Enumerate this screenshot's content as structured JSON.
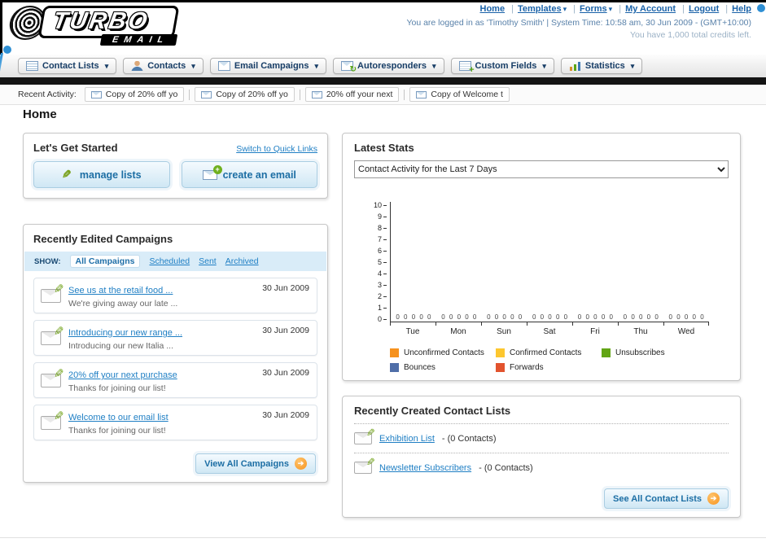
{
  "header": {
    "logo_title": "TURBO",
    "logo_subtitle": "EMAIL",
    "links": [
      {
        "label": "Home"
      },
      {
        "label": "Templates"
      },
      {
        "label": "Forms"
      },
      {
        "label": "My Account"
      },
      {
        "label": "Logout"
      },
      {
        "label": "Help"
      }
    ],
    "session_info": "You are logged in as 'Timothy Smith' | System Time: 10:58 am, 30 Jun 2009 - (GMT+10:00)",
    "credits_info": "You have 1,000 total credits left."
  },
  "nav": {
    "tabs": [
      {
        "label": "Contact Lists"
      },
      {
        "label": "Contacts"
      },
      {
        "label": "Email Campaigns"
      },
      {
        "label": "Autoresponders"
      },
      {
        "label": "Custom Fields"
      },
      {
        "label": "Statistics"
      }
    ]
  },
  "activity_bar": {
    "label": "Recent Activity:",
    "items": [
      "Copy of 20% off yo",
      "Copy of 20% off yo",
      "20% off your next",
      "Copy of Welcome t"
    ]
  },
  "page": {
    "title": "Home"
  },
  "get_started": {
    "title": "Let's Get Started",
    "switch_link": "Switch to Quick Links",
    "manage_lists_label": "manage lists",
    "create_email_label": "create an email"
  },
  "campaigns": {
    "title": "Recently Edited Campaigns",
    "show_label": "SHOW:",
    "filters": [
      "All Campaigns",
      "Scheduled",
      "Sent",
      "Archived"
    ],
    "active_filter": "All Campaigns",
    "rows": [
      {
        "title": "See us at the retail food ...",
        "subtitle": "We're giving away our late ...",
        "date": "30 Jun 2009"
      },
      {
        "title": "Introducing our new range ...",
        "subtitle": "Introducing our new Italia ...",
        "date": "30 Jun 2009"
      },
      {
        "title": "20% off your next purchase",
        "subtitle": "Thanks for joining our list!",
        "date": "30 Jun 2009"
      },
      {
        "title": "Welcome to our email list",
        "subtitle": "Thanks for joining our list!",
        "date": "30 Jun 2009"
      }
    ],
    "view_all_label": "View All Campaigns"
  },
  "stats": {
    "title": "Latest Stats",
    "dropdown_value": "Contact Activity for the Last 7 Days",
    "chart_data": {
      "type": "bar",
      "title": "Contact Activity for the Last 7 Days",
      "categories": [
        "Tue",
        "Mon",
        "Sun",
        "Sat",
        "Fri",
        "Thu",
        "Wed"
      ],
      "series": [
        {
          "name": "Unconfirmed Contacts",
          "color": "#f6921e",
          "values": [
            0,
            0,
            0,
            0,
            0,
            0,
            0
          ]
        },
        {
          "name": "Confirmed Contacts",
          "color": "#fdc72f",
          "values": [
            0,
            0,
            0,
            0,
            0,
            0,
            0
          ]
        },
        {
          "name": "Unsubscribes",
          "color": "#62a515",
          "values": [
            0,
            0,
            0,
            0,
            0,
            0,
            0
          ]
        },
        {
          "name": "Bounces",
          "color": "#4f6ea8",
          "values": [
            0,
            0,
            0,
            0,
            0,
            0,
            0
          ]
        },
        {
          "name": "Forwards",
          "color": "#e2532e",
          "values": [
            0,
            0,
            0,
            0,
            0,
            0,
            0
          ]
        }
      ],
      "ylim": [
        0,
        10
      ],
      "y_ticks": [
        0,
        1,
        2,
        3,
        4,
        5,
        6,
        7,
        8,
        9,
        10
      ],
      "grid": false,
      "value_labels": true,
      "legend_position": "bottom"
    }
  },
  "contact_lists": {
    "title": "Recently Created Contact Lists",
    "rows": [
      {
        "name": "Exhibition List",
        "detail": "- (0 Contacts)"
      },
      {
        "name": "Newsletter Subscribers",
        "detail": "- (0 Contacts)"
      }
    ],
    "see_all_label": "See All Contact Lists"
  }
}
